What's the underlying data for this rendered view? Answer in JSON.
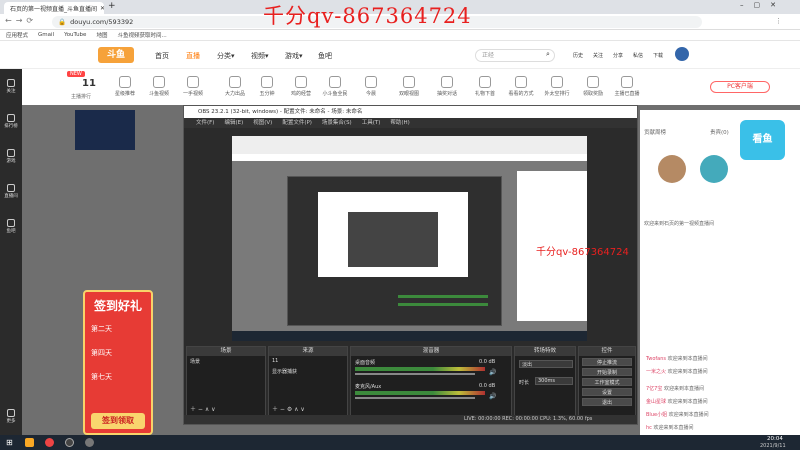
{
  "browser": {
    "tab_title": "石页的第一视频直播_斗鱼直播间",
    "url": "douyu.com/593392",
    "bookmarks": [
      "应用程式",
      "Gmail",
      "YouTube",
      "地图",
      "斗鱼视频获取时间..."
    ]
  },
  "header": {
    "logo": "斗鱼",
    "nav": [
      "首页",
      "直播",
      "分类▾",
      "视频▾",
      "游戏▾",
      "鱼吧"
    ],
    "search_placeholder": "正经",
    "user_items": [
      "历史",
      "关注",
      "分享",
      "私信",
      "下载",
      "帮"
    ]
  },
  "categories": [
    "主播排行",
    "星级推荐",
    "斗鱼视频",
    "一手视频",
    "大力出品",
    "五分钟",
    "鸡的经营",
    "小斗鱼全民",
    "今晨",
    "双眼视图",
    "抽奖对话",
    "礼物下首",
    "看看的方式",
    "外太空排行",
    "领取奖励",
    "主播已直播",
    "百鸟地图",
    "小程序SDT"
  ],
  "top_badges": {
    "rank": "11",
    "rank_label": "主播排行"
  },
  "pc_button": "PC客户端",
  "sidebar": [
    "关注",
    "排行榜",
    "游戏",
    "直播间",
    "鱼吧",
    "更多"
  ],
  "watermark": "千分qv-867364724",
  "preview_watermark": "千分qv-867364724",
  "obs": {
    "title": "OBS 23.2.1 (32-bit, windows) - 配置文件: 未命名 - 场景: 未命名",
    "menu": [
      "文件(F)",
      "编辑(E)",
      "视图(V)",
      "配置文件(P)",
      "场景集合(S)",
      "工具(T)",
      "帮助(H)"
    ],
    "docks": {
      "scenes": {
        "title": "场景",
        "items": [
          "场景"
        ]
      },
      "sources": {
        "title": "来源",
        "items": [
          "11",
          "显示器捕获"
        ]
      },
      "mixer": {
        "title": "混音器",
        "tracks": [
          {
            "name": "桌面音频",
            "db": "0.0 dB"
          },
          {
            "name": "麦克风/Aux",
            "db": "0.0 dB"
          }
        ]
      },
      "transitions": {
        "title": "转场特效",
        "type": "淡出",
        "duration_label": "时长",
        "duration": "300ms"
      },
      "controls": {
        "title": "控件",
        "buttons": [
          "停止推流",
          "开始录制",
          "工作室模式",
          "设置",
          "退出"
        ]
      }
    },
    "status": "LIVE: 00:00:00     REC: 00:00:00     CPU: 1.3%, 60.00 fps"
  },
  "sign_in": {
    "title": "签到好礼",
    "days": [
      "第二天",
      "第四天",
      "第七天"
    ],
    "button": "签到领取"
  },
  "chat": [
    {
      "user": "Twofans",
      "msg": "欢迎来到本直播间"
    },
    {
      "user": "一米之火",
      "msg": "欢迎来到本直播间"
    },
    {
      "user": "7亿7宝",
      "msg": "欢迎来到本直播间"
    },
    {
      "user": "金山星球",
      "msg": "欢迎来到本直播间"
    },
    {
      "user": "Blue小姐",
      "msg": "欢迎来到本直播间"
    },
    {
      "user": "hc",
      "msg": "欢迎来到本直播间"
    }
  ],
  "rightcol": {
    "tabs": [
      "贡献周榜",
      "贵宾(0)"
    ],
    "anchor": "看鱼",
    "notice": "欢迎来到石页的第一视频直播间"
  },
  "taskbar": {
    "time": "20:04",
    "date": "2021/9/11"
  }
}
